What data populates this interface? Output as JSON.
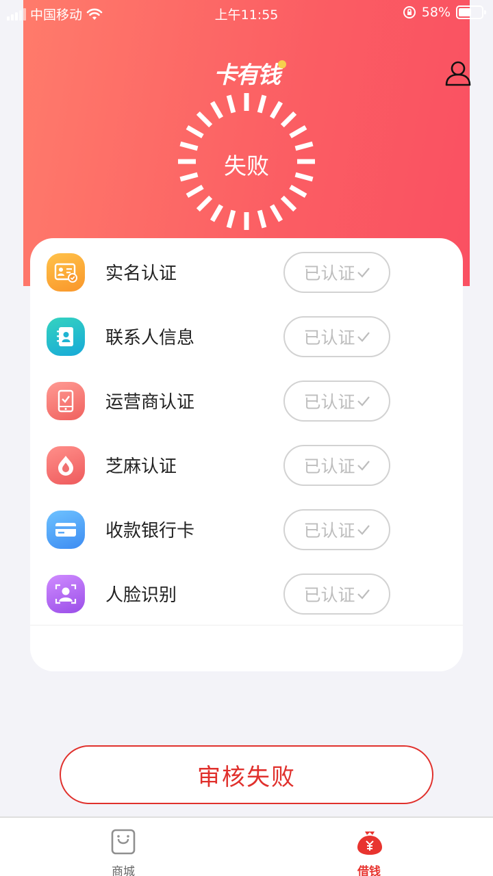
{
  "status_bar": {
    "carrier": "中国移动",
    "time": "上午11:55",
    "battery": "58%"
  },
  "header": {
    "logo_text": "卡有钱",
    "spinner_status": "失败"
  },
  "verification_items": [
    {
      "label": "实名认证",
      "status": "已认证",
      "icon": "id-card-icon"
    },
    {
      "label": "联系人信息",
      "status": "已认证",
      "icon": "contacts-icon"
    },
    {
      "label": "运营商认证",
      "status": "已认证",
      "icon": "phone-check-icon"
    },
    {
      "label": "芝麻认证",
      "status": "已认证",
      "icon": "sesame-icon"
    },
    {
      "label": "收款银行卡",
      "status": "已认证",
      "icon": "bank-card-icon"
    },
    {
      "label": "人脸识别",
      "status": "已认证",
      "icon": "face-scan-icon"
    }
  ],
  "main_button": {
    "label": "审核失败"
  },
  "tab_bar": {
    "tabs": [
      {
        "label": "商城",
        "icon": "shopping-bag-icon",
        "active": false
      },
      {
        "label": "借钱",
        "icon": "money-bag-icon",
        "active": true
      }
    ]
  },
  "colors": {
    "hero_start": "#ff7b6b",
    "hero_end": "#fa5062",
    "accent_red": "#e0302c",
    "badge_gray": "#bdbdbd"
  }
}
